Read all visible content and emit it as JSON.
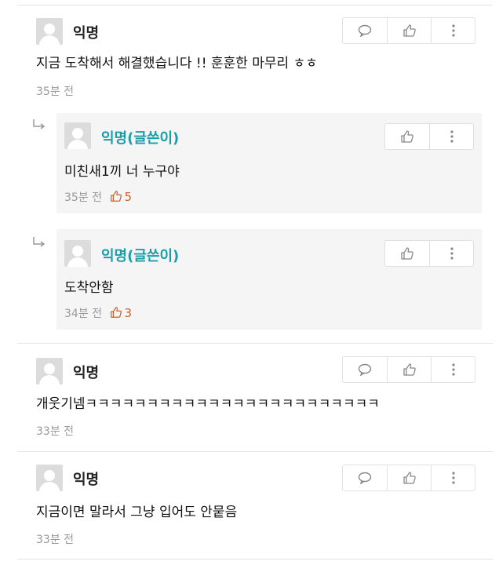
{
  "comments": [
    {
      "author": "익명",
      "text": "지금 도착해서 해결했습니다 !! 훈훈한 마무리 ㅎㅎ",
      "time": "35분 전"
    },
    {
      "author": "익명(글쓴이)",
      "text": "미친새1끼 너 누구야",
      "time": "35분 전",
      "likes": "5"
    },
    {
      "author": "익명(글쓴이)",
      "text": "도착안함",
      "time": "34분 전",
      "likes": "3"
    },
    {
      "author": "익명",
      "text": "개웃기넴ㅋㅋㅋㅋㅋㅋㅋㅋㅋㅋㅋㅋㅋㅋㅋㅋㅋㅋㅋㅋㅋㅋㅋㅋ",
      "time": "33분 전"
    },
    {
      "author": "익명",
      "text": "지금이면 말라서 그냥 입어도 안뭍음",
      "time": "33분 전"
    }
  ],
  "icons": {
    "reply": "speech-bubble-icon",
    "like": "thumbs-up-icon",
    "more": "more-vertical-icon",
    "reply_arrow": "reply-arrow-icon"
  },
  "colors": {
    "writer_name": "#1a9ea8",
    "like_count": "#c8622a"
  }
}
